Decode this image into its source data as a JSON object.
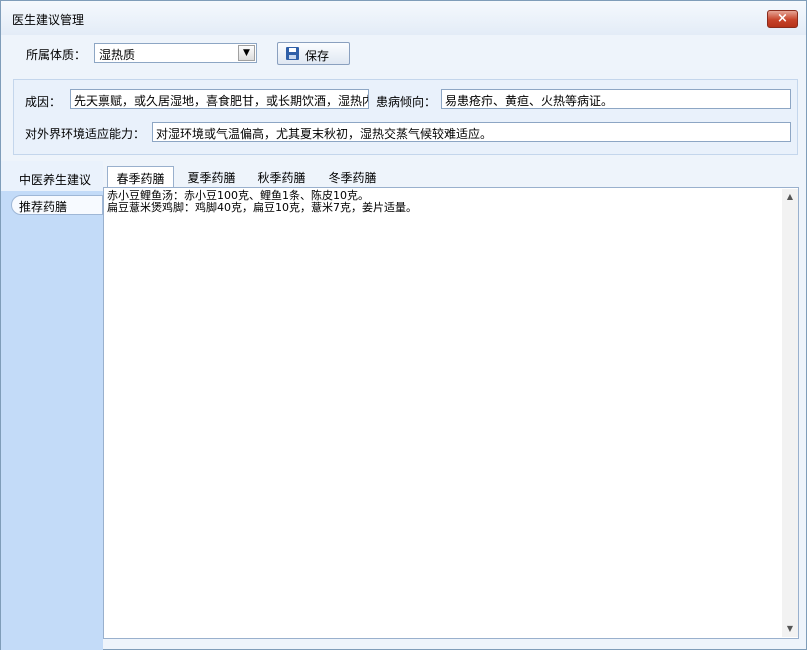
{
  "window": {
    "title": "医生建议管理",
    "close_glyph": "×"
  },
  "toolbar": {
    "constitution_label": "所属体质：",
    "constitution_value": "湿热质",
    "save_label": "保存"
  },
  "info": {
    "cause_label": "成因：",
    "cause_value": "先天禀赋，或久居湿地，喜食肥甘，或长期饮酒，湿热内",
    "tendency_label": "患病倾向：",
    "tendency_value": "易患疮疖、黄疸、火热等病证。",
    "adapt_label": "对外界环境适应能力：",
    "adapt_value": "对湿环境或气温偏高，尤其夏末秋初，湿热交蒸气候较难适应。"
  },
  "sidebar": {
    "header": "中医养生建议",
    "items": [
      {
        "label": "推荐药膳"
      }
    ]
  },
  "tabs": [
    {
      "label": "春季药膳",
      "active": true
    },
    {
      "label": "夏季药膳",
      "active": false
    },
    {
      "label": "秋季药膳",
      "active": false
    },
    {
      "label": "冬季药膳",
      "active": false
    }
  ],
  "editor": {
    "content": "赤小豆鲤鱼汤：赤小豆100克、鲤鱼1条、陈皮10克。\n扁豆薏米煲鸡脚：鸡脚40克，扁豆10克，薏米7克，姜片适量。"
  }
}
